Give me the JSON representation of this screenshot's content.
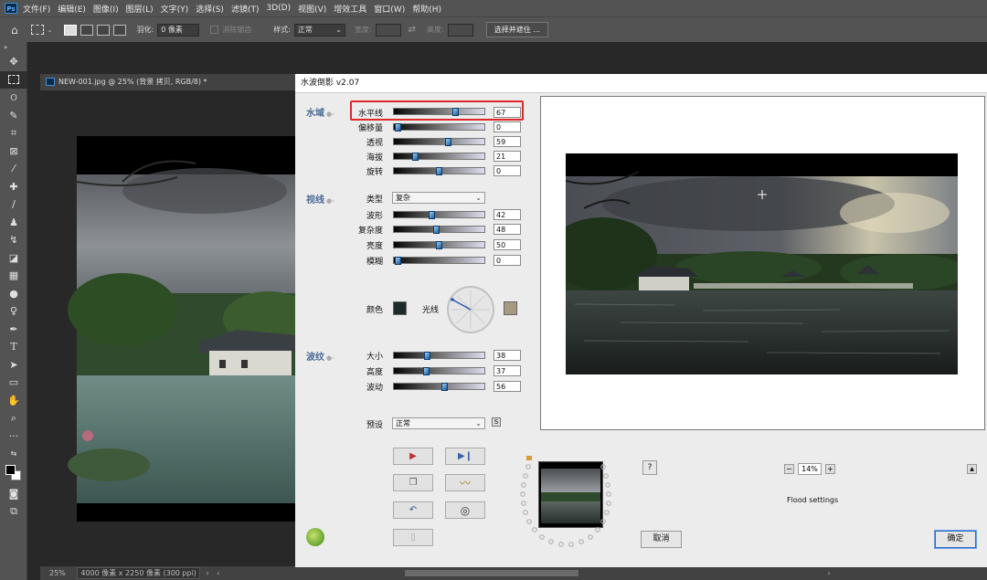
{
  "menubar": {
    "logo": "Ps",
    "items": [
      "文件(F)",
      "编辑(E)",
      "图像(I)",
      "图层(L)",
      "文字(Y)",
      "选择(S)",
      "滤镜(T)",
      "3D(D)",
      "视图(V)",
      "增效工具",
      "窗口(W)",
      "帮助(H)"
    ]
  },
  "options": {
    "feather_label": "羽化:",
    "feather_value": "0 像素",
    "antialias_label": "消除锯齿",
    "style_label": "样式:",
    "style_value": "正常",
    "width_label": "宽度:",
    "height_label": "高度:",
    "select_mask_button": "选择并遮住 ..."
  },
  "document": {
    "tab_title": "NEW-001.jpg @ 25% (背景 拷贝, RGB/8) *",
    "zoom": "25%",
    "doc_info": "4000 像素 x 2250 像素 (300 ppi)"
  },
  "dialog": {
    "title": "水波倒影 v2.07",
    "sections": {
      "water": "水域",
      "view": "视线",
      "waves": "波纹"
    },
    "water_params": [
      {
        "label": "水平线",
        "value": "67"
      },
      {
        "label": "偏移量",
        "value": "0"
      },
      {
        "label": "透视",
        "value": "59"
      },
      {
        "label": "海拔",
        "value": "21"
      },
      {
        "label": "旋转",
        "value": "0"
      }
    ],
    "view_type_label": "类型",
    "view_type_value": "复杂",
    "view_params": [
      {
        "label": "波形",
        "value": "42"
      },
      {
        "label": "复杂度",
        "value": "48"
      },
      {
        "label": "亮度",
        "value": "50"
      },
      {
        "label": "模糊",
        "value": "0"
      }
    ],
    "color_label": "颜色",
    "light_label": "光线",
    "wave_params": [
      {
        "label": "大小",
        "value": "38"
      },
      {
        "label": "高度",
        "value": "37"
      },
      {
        "label": "波动",
        "value": "56"
      }
    ],
    "preset_label": "预设",
    "preset_value": "正常",
    "preset_button": "S",
    "help_button": "?",
    "cancel_button": "取消",
    "ok_button": "确定",
    "zoom_minus": "−",
    "zoom_value": "14%",
    "zoom_plus": "+",
    "flood_settings": "Flood settings",
    "collapse_button": "▲"
  },
  "colors": {
    "accent_section": "#4b6b95",
    "highlight": "#e0262a",
    "ps_panel": "#535353"
  }
}
